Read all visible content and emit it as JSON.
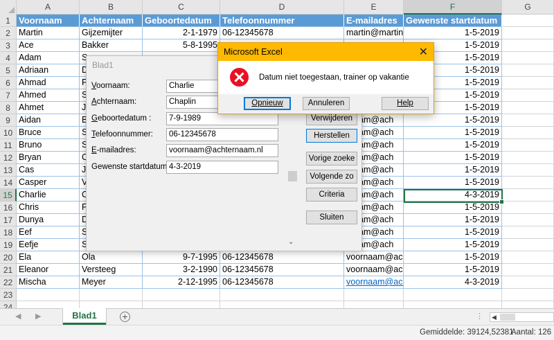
{
  "sheet": {
    "columns": [
      "A",
      "B",
      "C",
      "D",
      "E",
      "F",
      "G"
    ],
    "selected_column": "F",
    "row_numbers": [
      "1",
      "2",
      "3",
      "4",
      "5",
      "6",
      "7",
      "8",
      "9",
      "10",
      "11",
      "12",
      "13",
      "14",
      "15",
      "16",
      "17",
      "18",
      "19",
      "20",
      "21",
      "22",
      "23",
      "24"
    ],
    "selected_row": "15",
    "headers": [
      "Voornaam",
      "Achternaam",
      "Geboortedatum",
      "Telefoonnummer",
      "E-mailadres",
      "Gewenste startdatum"
    ],
    "rows": [
      [
        "Martin",
        "Gijzemijter",
        "2-1-1979",
        "06-12345678",
        "martin@martin",
        "1-5-2019"
      ],
      [
        "Ace",
        "Bakker",
        "5-8-1995",
        "",
        "",
        "1-5-2019"
      ],
      [
        "Adam",
        "S",
        "",
        "",
        "",
        "1-5-2019"
      ],
      [
        "Adriaan",
        "D",
        "",
        "",
        "",
        "1-5-2019"
      ],
      [
        "Ahmad",
        "P",
        "",
        "",
        "",
        "1-5-2019"
      ],
      [
        "Ahmed",
        "S",
        "",
        "",
        "",
        "1-5-2019"
      ],
      [
        "Ahmet",
        "Jo",
        "",
        "",
        "",
        "1-5-2019"
      ],
      [
        "Aidan",
        "B",
        "",
        "",
        "rnaam@ach",
        "1-5-2019"
      ],
      [
        "Bruce",
        "S",
        "",
        "",
        "rnaam@ach",
        "1-5-2019"
      ],
      [
        "Bruno",
        "S",
        "",
        "",
        "rnaam@ach",
        "1-5-2019"
      ],
      [
        "Bryan",
        "O",
        "",
        "",
        "rnaam@ach",
        "1-5-2019"
      ],
      [
        "Cas",
        "Ja",
        "",
        "",
        "rnaam@ach",
        "1-5-2019"
      ],
      [
        "Casper",
        "V",
        "",
        "",
        "rnaam@ach",
        "1-5-2019"
      ],
      [
        "Charlie",
        "C",
        "",
        "",
        "rnaam@ach",
        "4-3-2019"
      ],
      [
        "Chris",
        "P",
        "",
        "",
        "rnaam@ach",
        "1-5-2019"
      ],
      [
        "Dunya",
        "D",
        "",
        "",
        "rnaam@ach",
        "1-5-2019"
      ],
      [
        "Eef",
        "S",
        "",
        "",
        "rnaam@ach",
        "1-5-2019"
      ],
      [
        "Eefje",
        "S",
        "",
        "",
        "rnaam@ach",
        "1-5-2019"
      ],
      [
        "Ela",
        "Ola",
        "9-7-1995",
        "06-12345678",
        "voornaam@ach",
        "1-5-2019"
      ],
      [
        "Eleanor",
        "Versteeg",
        "3-2-1990",
        "06-12345678",
        "voornaam@ach",
        "1-5-2019"
      ],
      [
        "Mischa",
        "Meyer",
        "2-12-1995",
        "06-12345678",
        "voornaam@ach",
        "4-3-2019"
      ]
    ]
  },
  "sheet_tab": {
    "name": "Blad1",
    "add_icon": "plus-circle-icon"
  },
  "status": {
    "average": "Gemiddelde: 39124,52381",
    "count": "Aantal: 126"
  },
  "userform": {
    "title": "Blad1",
    "fields": [
      {
        "label_pre": "",
        "label_ul": "V",
        "label_post": "oornaam:",
        "value": "Charlie"
      },
      {
        "label_pre": "",
        "label_ul": "A",
        "label_post": "chternaam:",
        "value": "Chaplin"
      },
      {
        "label_pre": "",
        "label_ul": "G",
        "label_post": "eboortedatum :",
        "value": "7-9-1989"
      },
      {
        "label_pre": "",
        "label_ul": "T",
        "label_post": "elefoonnummer:",
        "value": "06-12345678"
      },
      {
        "label_pre": "",
        "label_ul": "E",
        "label_post": "-mailadres:",
        "value": "voornaam@achternaam.nl"
      },
      {
        "label_pre": "Gewenste startdatum:",
        "label_ul": "",
        "label_post": "",
        "value": "4-3-2019"
      }
    ],
    "buttons": {
      "delete": "Verwijderen",
      "restore": "Herstellen",
      "prev": "Vorige zoeke",
      "next": "Volgende zo",
      "criteria": "Criteria",
      "close": "Sluiten"
    }
  },
  "msgbox": {
    "title": "Microsoft Excel",
    "message": "Datum niet toegestaan, trainer op vakantie",
    "icon": "error-icon",
    "retry": "Opnieuw",
    "cancel": "Annuleren",
    "help": "Help"
  },
  "colors": {
    "header_fill": "#5b9bd5",
    "excel_green": "#217346",
    "msgbox_title": "#ffb900",
    "error_red": "#e81123",
    "link_blue": "#0563c1"
  }
}
